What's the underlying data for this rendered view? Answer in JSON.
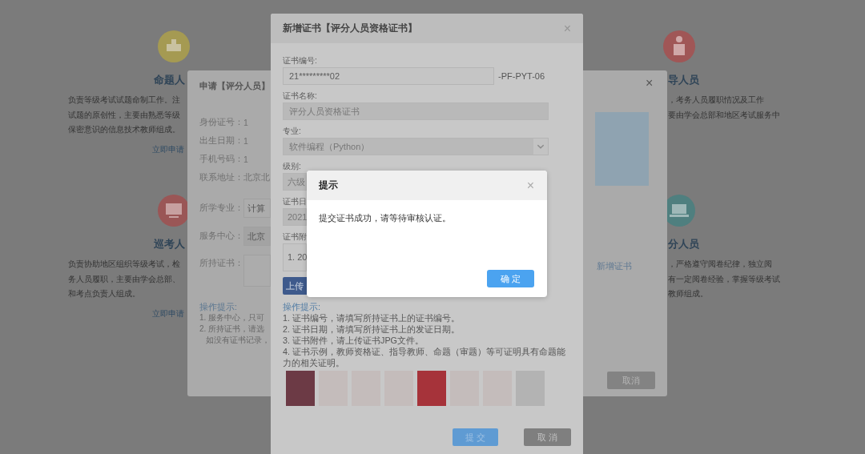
{
  "background_page": {
    "left_cards": [
      {
        "title": "命题人",
        "description": [
          "负责等级考试试题命制工作。注",
          "试题的原创性，主要由熟悉等级",
          "保密意识的信息技术教师组成。"
        ],
        "link": "立即申请"
      },
      {
        "title": "巡考人",
        "description": [
          "负责协助地区组织等级考试，检",
          "务人员履职，主要由学会总部、",
          "和考点负责人组成。"
        ],
        "link": "立即申请"
      }
    ],
    "right_cards": [
      {
        "title": "导人员",
        "description": [
          "，考务人员履职情况及工作",
          "要由学会总部和地区考试服务中"
        ]
      },
      {
        "title": "分人员",
        "description": [
          "，严格遵守阅卷纪律，独立阅",
          "有一定阅卷经验，掌握等级考试",
          "教师组成。"
        ]
      }
    ]
  },
  "apply_dialog": {
    "title": "申请【评分人员】",
    "close": "×",
    "info": [
      {
        "label": "身份证号：",
        "value": "1"
      },
      {
        "label": "出生日期：",
        "value": "1"
      },
      {
        "label": "手机号码：",
        "value": "1"
      },
      {
        "label": "联系地址：",
        "value": "北京北"
      }
    ],
    "fields": [
      {
        "label": "所学专业：",
        "kind": "select",
        "value": "计算"
      },
      {
        "label": "服务中心：",
        "kind": "readonly",
        "value": "北京"
      },
      {
        "label": "所持证书：",
        "kind": "list"
      }
    ],
    "tips_title": "操作提示:",
    "tips": [
      "1. 服务中心，只可",
      "2. 所持证书，请选",
      "如没有证书记录，"
    ],
    "add_certificate_link": "新增证书",
    "cancel_button": "取消"
  },
  "certificate_dialog": {
    "title": "新增证书【评分人员资格证书】",
    "close": "×",
    "fields": [
      {
        "label": "证书编号:",
        "kind": "text",
        "value": "21*********02",
        "suffix": "-PF-PYT-06"
      },
      {
        "label": "证书名称:",
        "kind": "readonly",
        "value": "评分人员资格证书"
      },
      {
        "label": "专业:",
        "kind": "select",
        "value": "软件编程（Python）"
      },
      {
        "label": "级别:",
        "kind": "covered",
        "value": "六级"
      },
      {
        "label": "证书日",
        "kind": "covered",
        "value": "2021"
      },
      {
        "label": "证书附",
        "kind": "area",
        "value": "1. 20"
      }
    ],
    "upload_button": "上传",
    "tips_title": "操作提示:",
    "tips": [
      "1. 证书编号，请填写所持证书上的证书编号。",
      "2. 证书日期，请填写所持证书上的发证日期。",
      "3. 证书附件，请上传证书JPG文件。",
      "4. 证书示例，教师资格证、指导教师、命题（审题）等可证明具有命题能力的相关证明。"
    ],
    "sample_images": [
      {
        "kind": "cover"
      },
      {
        "kind": "page"
      },
      {
        "kind": "page"
      },
      {
        "kind": "page"
      },
      {
        "kind": "red"
      },
      {
        "kind": "page"
      },
      {
        "kind": "page"
      },
      {
        "kind": "grey"
      }
    ],
    "submit_button": "提 交",
    "cancel_button": "取 消"
  },
  "alert": {
    "title": "提示",
    "close": "×",
    "message": "提交证书成功，请等待审核认证。",
    "ok_button": "确 定"
  }
}
